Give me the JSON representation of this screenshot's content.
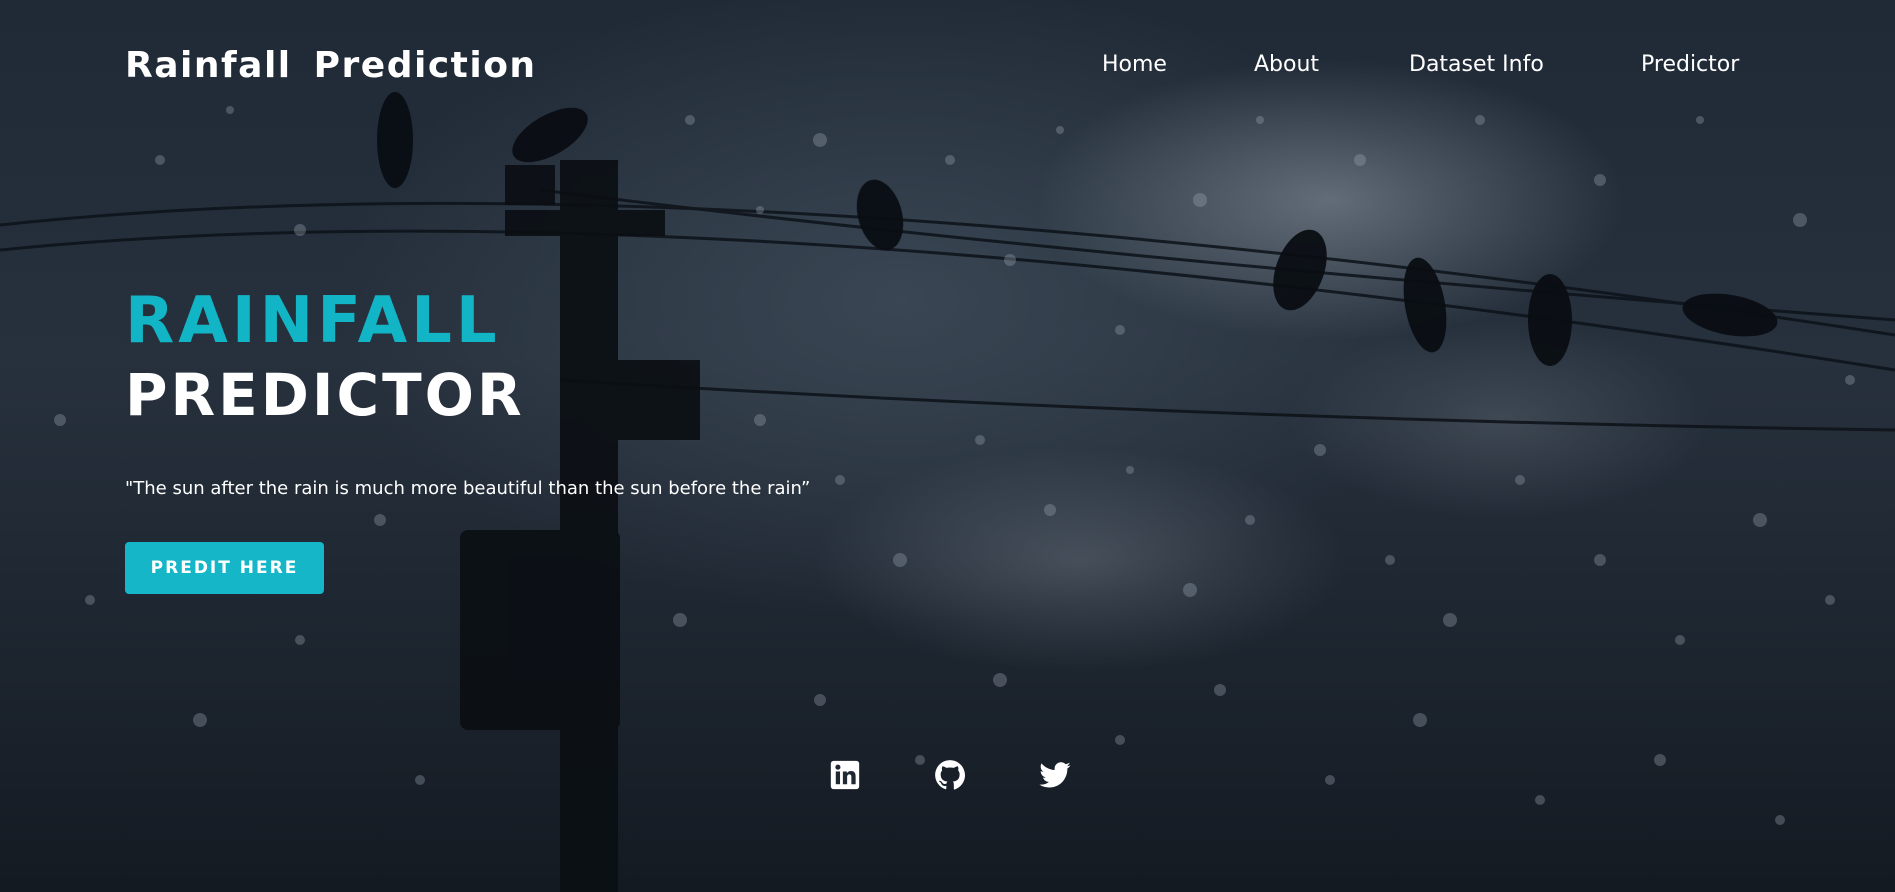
{
  "header": {
    "brand": "Rainfall  Prediction",
    "nav": [
      {
        "label": "Home"
      },
      {
        "label": "About"
      },
      {
        "label": "Dataset Info"
      },
      {
        "label": "Predictor"
      }
    ]
  },
  "hero": {
    "title_line1": "RAINFALL",
    "title_line2": "PREDICTOR",
    "quote": "\"The sun after the rain is much more beautiful than the sun before the rain”",
    "cta_label": "PREDIT HERE"
  },
  "social": {
    "icons": [
      "linkedin-icon",
      "github-icon",
      "twitter-icon"
    ]
  },
  "colors": {
    "accent": "#12b5c6",
    "button": "#14b6c8",
    "text": "#ffffff",
    "background": "#1f2833"
  }
}
